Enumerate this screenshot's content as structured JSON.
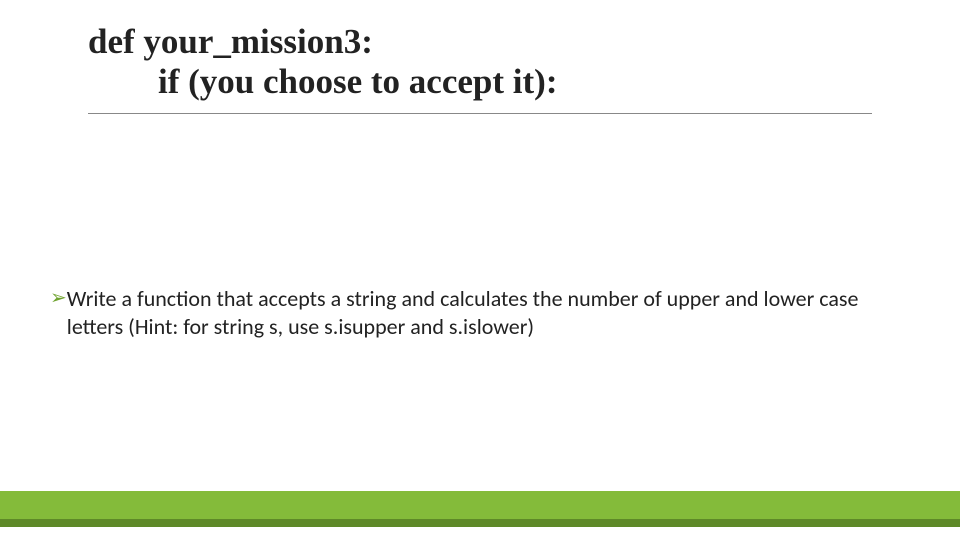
{
  "title": {
    "line1": "def your_mission3:",
    "line2": "if (you choose to accept it):"
  },
  "bullets": [
    {
      "text": "Write a function that accepts a string and calculates the number of upper and lower case letters (Hint: for string s, use s.isupper and s.islower)"
    }
  ],
  "colors": {
    "accent": "#6fa32f",
    "footer_dark": "#5e8928",
    "footer_light": "#84bb3a"
  }
}
